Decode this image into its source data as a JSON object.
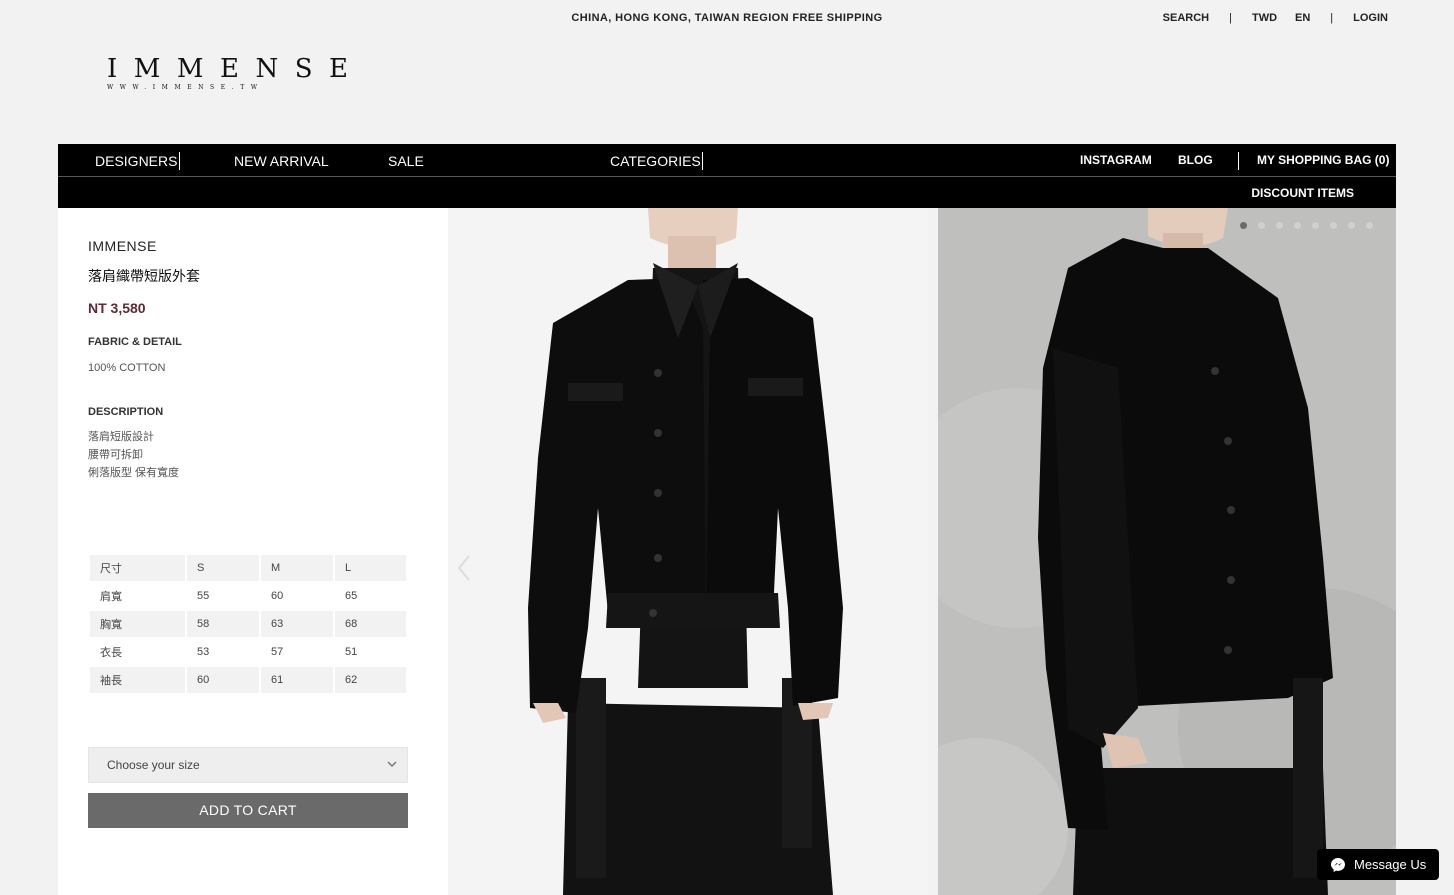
{
  "topbar": {
    "shipping": "CHINA, HONG KONG, TAIWAN REGION FREE SHIPPING",
    "search": "SEARCH",
    "sep1": "|",
    "currency": "TWD",
    "language": "EN",
    "sep2": "|",
    "login": "LOGIN"
  },
  "logo": {
    "main": "IMMENSE",
    "sub": "WWW.IMMENSE.TW"
  },
  "nav": {
    "designers": "DESIGNERS",
    "new_arrival": "NEW ARRIVAL",
    "sale": "SALE",
    "categories": "CATEGORIES",
    "instagram": "INSTAGRAM",
    "blog": "BLOG",
    "bag": "MY SHOPPING BAG (0)",
    "discount": "DISCOUNT ITEMS"
  },
  "product": {
    "brand": "IMMENSE",
    "name": "落肩織帶短版外套",
    "price": "NT 3,580",
    "fabric_label": "FABRIC & DETAIL",
    "fabric_value": "100% COTTON",
    "description_label": "DESCRIPTION",
    "description_lines": [
      "落肩短版設計",
      "腰帶可拆卸",
      "俐落版型 保有寬度"
    ]
  },
  "size_table": {
    "header": [
      "尺寸",
      "S",
      "M",
      "L"
    ],
    "rows": [
      [
        "肩寬",
        "55",
        "60",
        "65"
      ],
      [
        "胸寬",
        "58",
        "63",
        "68"
      ],
      [
        "衣長",
        "53",
        "57",
        "51"
      ],
      [
        "袖長",
        "60",
        "61",
        "62"
      ]
    ]
  },
  "size_select": {
    "placeholder": "Choose your size"
  },
  "add_to_cart": "ADD TO CART",
  "gallery": {
    "total_slides": 8,
    "active_slide": 1
  },
  "messenger": {
    "label": "Message Us"
  },
  "colors": {
    "price": "#5a2a35",
    "nav_bg": "#000000",
    "cart_btn": "#6a6a6a",
    "page_bg": "#f2f2f2"
  }
}
